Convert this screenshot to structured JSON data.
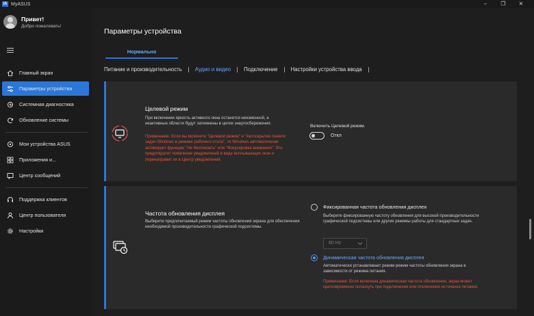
{
  "app": {
    "title": "MyASUS",
    "logo_text": "/A"
  },
  "window_controls": {
    "minimize": "–",
    "maximize": "❐",
    "close": "✕"
  },
  "user": {
    "greeting": "Привет!",
    "welcome": "Добро пожаловать!"
  },
  "sidebar": {
    "items": [
      {
        "label": "Главный экран",
        "icon": "home-icon"
      },
      {
        "label": "Параметры устройства",
        "icon": "sliders-icon",
        "active": true
      },
      {
        "label": "Системная диагностика",
        "icon": "diagnostics-icon"
      },
      {
        "label": "Обновление системы",
        "icon": "refresh-icon"
      },
      {
        "label": "Мои устройства ASUS",
        "icon": "devices-icon"
      },
      {
        "label": "Приложения и...",
        "icon": "apps-icon"
      },
      {
        "label": "Центр сообщений",
        "icon": "message-icon"
      },
      {
        "label": "Поддержка клиентов",
        "icon": "support-icon"
      },
      {
        "label": "Центр пользователя",
        "icon": "user-icon"
      },
      {
        "label": "Настройки",
        "icon": "gear-icon"
      }
    ]
  },
  "page": {
    "title": "Параметры устройства",
    "mode_tab": "Нормально",
    "tabs": [
      {
        "label": "Питание и производительность"
      },
      {
        "label": "Аудио и видео",
        "active": true
      },
      {
        "label": "Подключение"
      },
      {
        "label": "Настройки устройства ввода"
      }
    ]
  },
  "target_mode": {
    "title": "Целевой режим",
    "description": "При включении яркость активного окна останется неизменной, а неактивные области будут затемнены в целях энергосбережения.",
    "note": "Примечание. Если вы включите \"Целевой режим\" и \"Автоскрытие панели задач Windows в режиме рабочего стола\", то Windows автоматически активирует функцию \"Не беспокоить\" или \"Фокусировка внимания\". Это предотвратит появление уведомлений в виде всплывающих окон и перенаправит их в Центр уведомлений.",
    "toggle_label": "Включить Целевой режим.",
    "toggle_state": "Откл"
  },
  "refresh_rate": {
    "title": "Частота обновления дисплея",
    "description": "Выберите предпочитаемый режим  частоты обновления экрана для обеспечения необходимой производительности графической подсистемы.",
    "fixed_title": "Фиксированная частота обновления дисплея",
    "fixed_desc": "Выберите фиксированную частоту обновления для высокой производительности графической подсистемы или другие режимы работы для стандартных задач.",
    "select_value": "60  Hz",
    "dynamic_title": "Динамическая частота обновления дисплея",
    "dynamic_desc": "Автоматически устанавливает режим режим  частоты обновления экрана в зависимости от режима питания.",
    "dynamic_note": "Примечание: Если включена динамическая частота обновления, экран может кратковременно погаснуть при подключении или отключении источника питания."
  },
  "colors": {
    "accent": "#2c76d8",
    "note_red": "#e8563f",
    "link_blue": "#6aa8ff"
  }
}
